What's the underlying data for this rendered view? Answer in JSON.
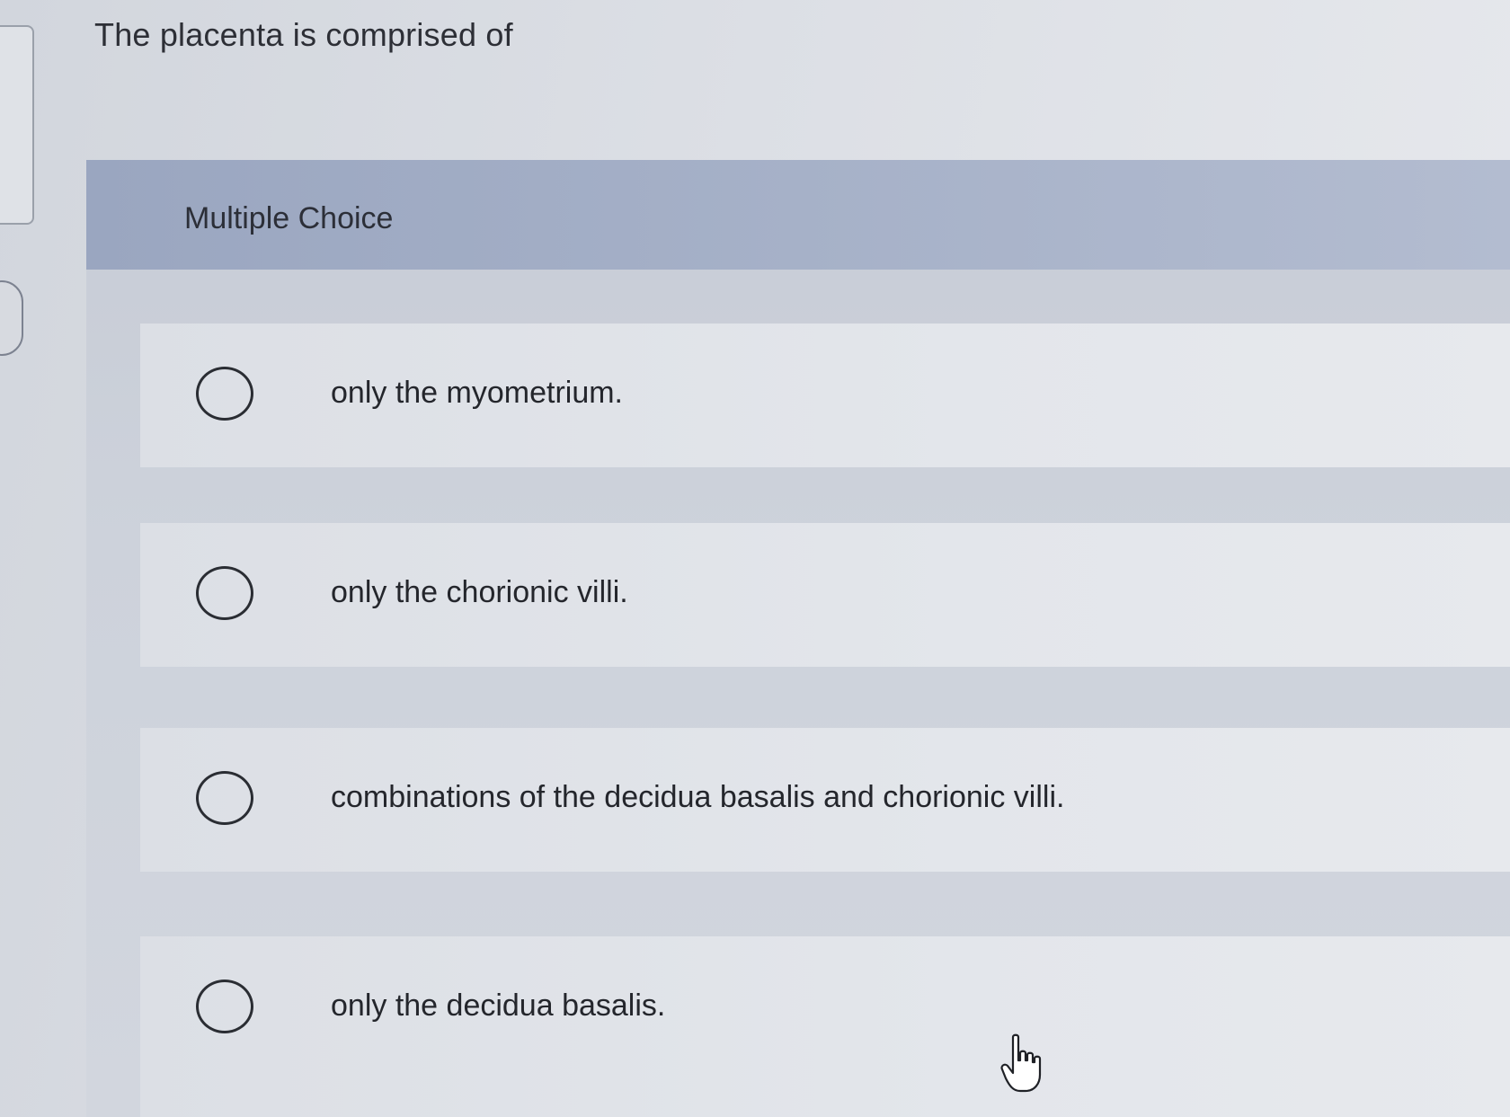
{
  "question": {
    "title": "The placenta is comprised of"
  },
  "panel": {
    "header_label": "Multiple Choice"
  },
  "options": [
    {
      "label": "only the myometrium."
    },
    {
      "label": "only the chorionic villi."
    },
    {
      "label": "combinations of the decidua basalis and chorionic villi."
    },
    {
      "label": "only the decidua basalis."
    }
  ],
  "icons": {
    "radio": "radio-unselected-icon",
    "cursor": "hand-pointer-cursor-icon"
  },
  "colors": {
    "header_bg": "#a6b1c8",
    "option_bg": "#e3e6eb",
    "text": "#24262c"
  }
}
